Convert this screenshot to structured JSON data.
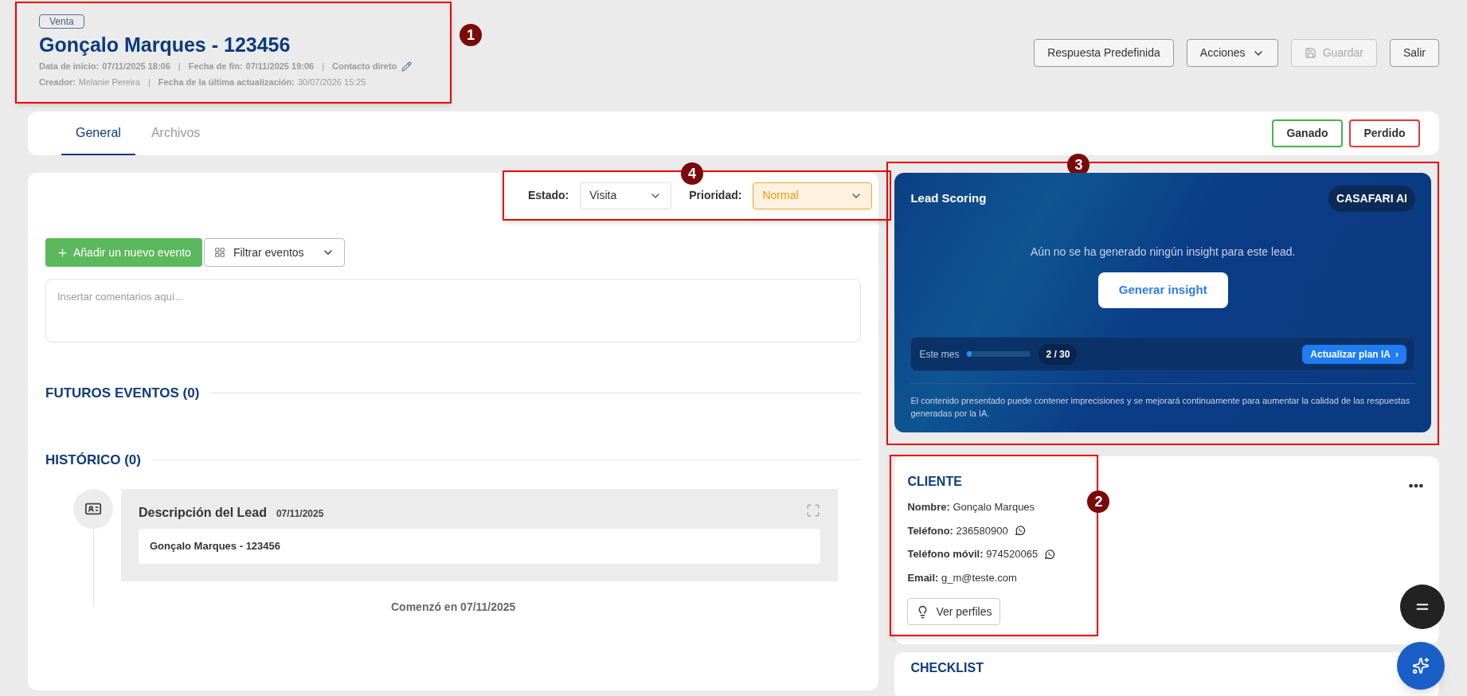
{
  "header": {
    "annotation": "1",
    "tag": "Venta",
    "title": "Gonçalo Marques - 123456",
    "separator": "|",
    "meta_rows": [
      [
        {
          "label": "Data de inicio:",
          "value": "07/11/2025 18:06"
        },
        {
          "label": "Fecha de fin:",
          "value": "07/11/2025 19:06"
        },
        {
          "label": "Contacto direto",
          "editable": true
        }
      ],
      [
        {
          "label": "Creador:",
          "value": "Melanie Pereira"
        },
        {
          "label": "Fecha de la última actualización:",
          "value": "30/07/2026 15:25"
        }
      ]
    ]
  },
  "actions": [
    {
      "label": "Respuesta Predefinida",
      "kind": "button",
      "disabled": false
    },
    {
      "label": "Acciones",
      "kind": "dropdown",
      "disabled": false
    },
    {
      "label": "Guardar",
      "kind": "save",
      "disabled": true
    },
    {
      "label": "Salir",
      "kind": "button",
      "disabled": false
    }
  ],
  "tabs": [
    {
      "label": "General",
      "selected": true
    },
    {
      "label": "Archivos",
      "selected": false
    }
  ],
  "outcome_buttons": [
    {
      "label": "Ganado",
      "color": "#4caf50"
    },
    {
      "label": "Perdido",
      "color": "#e53935"
    }
  ],
  "status": {
    "annotation": "4",
    "fields": [
      {
        "label": "Estado:",
        "value": "Visita",
        "highlighted": false
      },
      {
        "label": "Prioridad:",
        "value": "Normal",
        "highlighted": true
      }
    ]
  },
  "events": {
    "add_button": "Añadir un nuevo evento",
    "filter_button": "Filtrar eventos",
    "comment_placeholder": "Insertar comentarios aquí..."
  },
  "sections": [
    {
      "title": "FUTUROS EVENTOS (0)"
    },
    {
      "title": "HISTÓRICO (0)"
    }
  ],
  "timeline": [
    {
      "title": "Descripción del Lead",
      "date": "07/11/2025",
      "body": "Gonçalo Marques - 123456"
    }
  ],
  "timeline_footer": "Comenzó en 07/11/2025",
  "lead_scoring": {
    "annotation": "3",
    "title": "Lead Scoring",
    "badge": "CASAFARI AI",
    "message": "Aún no se ha generado ningún insight para este lead.",
    "button": "Generar insight",
    "usage_label": "Este mes",
    "level": 0.067,
    "count": "2 / 30",
    "upgrade": "Actualizar plan IA",
    "upgrade_arrow": "›",
    "disclaimer": "El contenido presentado puede contener imprecisiones y se mejorará continuamente para aumentar la calidad de las respuestas generadas por la IA."
  },
  "client": {
    "annotation": "2",
    "title": "CLIENTE",
    "fields": [
      {
        "label": "Nombre:",
        "value": "Gonçalo Marques",
        "whatsapp": false
      },
      {
        "label": "Teléfono:",
        "value": "236580900",
        "whatsapp": true
      },
      {
        "label": "Teléfono móvil:",
        "value": "974520065",
        "whatsapp": true
      },
      {
        "label": "Email:",
        "value": "g_m@teste.com",
        "whatsapp": false
      }
    ],
    "button": "Ver perfiles"
  },
  "checklist": {
    "title": "CHECKLIST"
  }
}
